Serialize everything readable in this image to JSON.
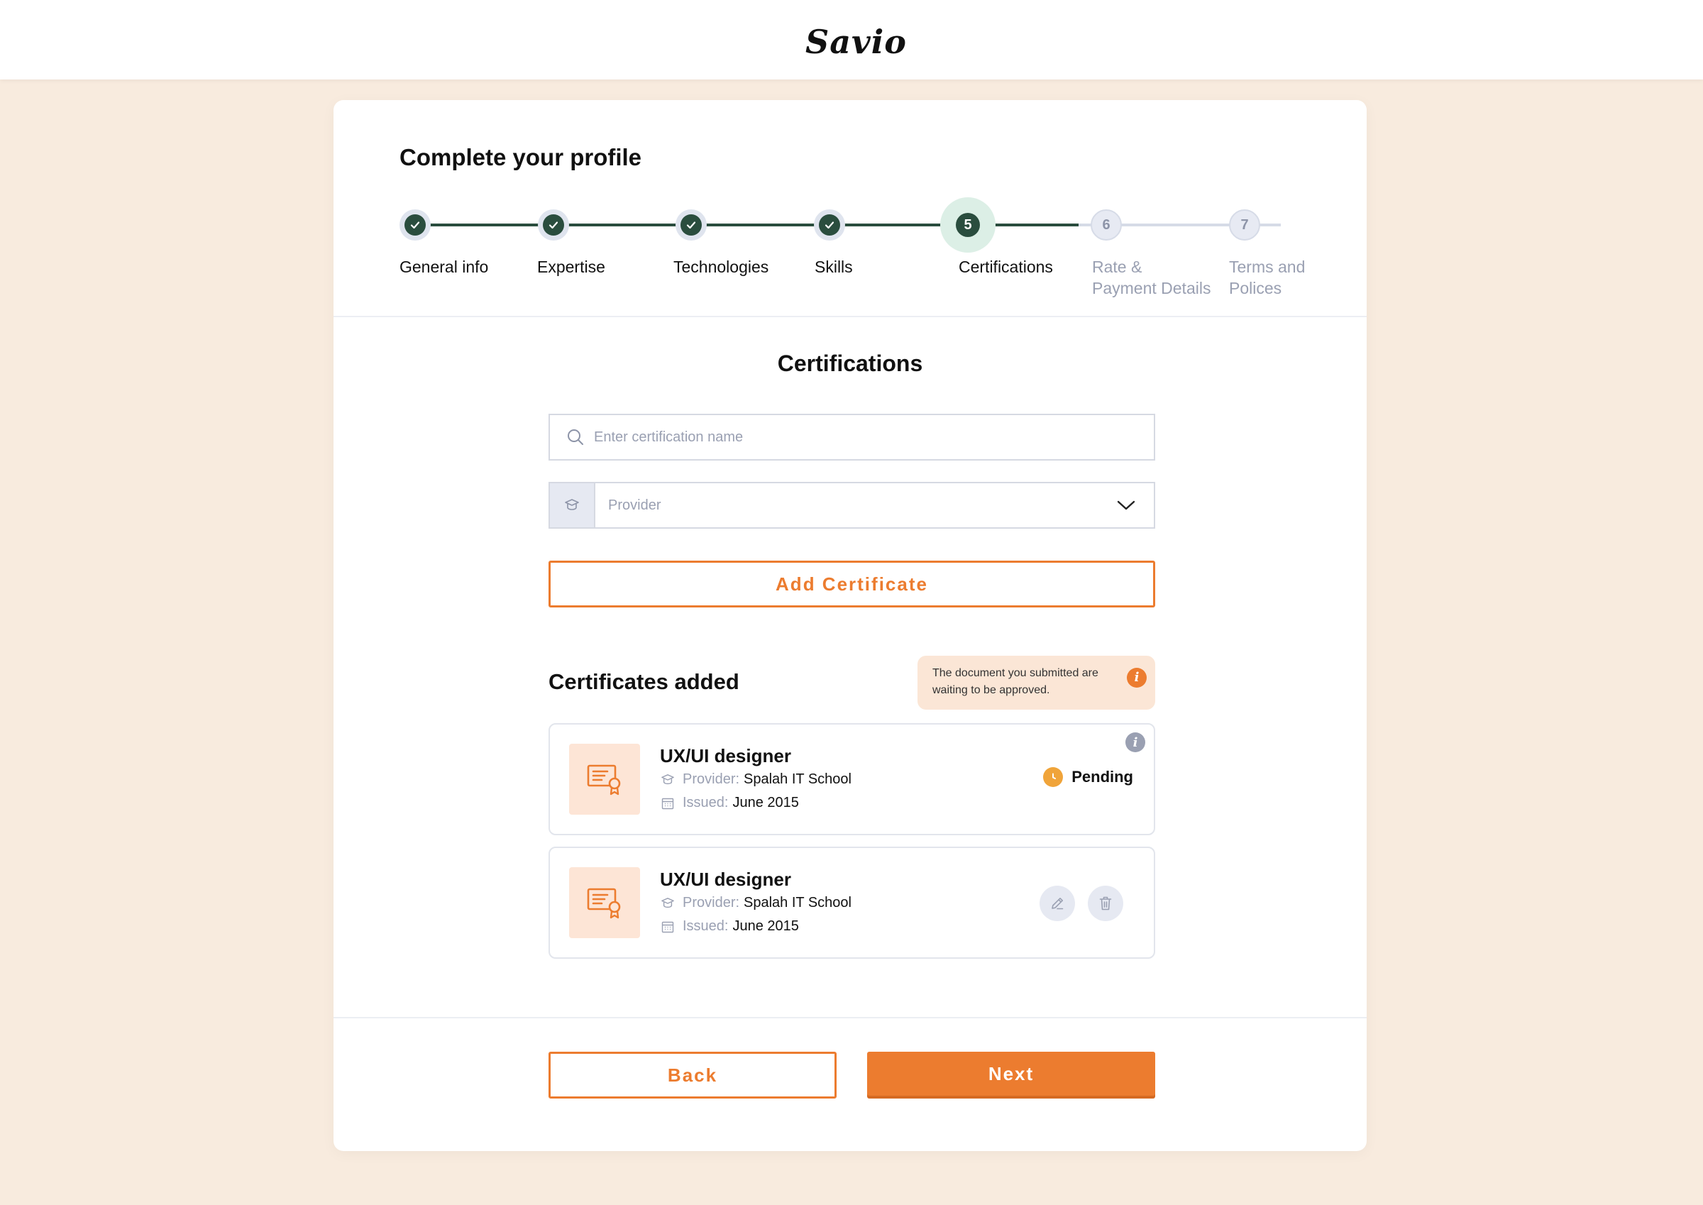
{
  "header": {
    "logo": "Savio"
  },
  "page": {
    "title": "Complete your profile"
  },
  "steps": [
    {
      "number": "1",
      "label": "General info",
      "state": "done"
    },
    {
      "number": "2",
      "label": "Expertise",
      "state": "done"
    },
    {
      "number": "3",
      "label": "Technologies",
      "state": "done"
    },
    {
      "number": "4",
      "label": "Skills",
      "state": "done"
    },
    {
      "number": "5",
      "label": "Certifications",
      "state": "active"
    },
    {
      "number": "6",
      "label": "Rate &\nPayment Details",
      "state": "todo"
    },
    {
      "number": "7",
      "label": "Terms and\nPolices",
      "state": "todo"
    }
  ],
  "section": {
    "title": "Certifications"
  },
  "form": {
    "search_placeholder": "Enter certification name",
    "search_value": "",
    "provider_placeholder": "Provider",
    "add_button": "Add Certificate"
  },
  "added": {
    "title": "Certificates added",
    "notice": "The document you submitted are waiting to be approved."
  },
  "certificates": [
    {
      "name": "UX/UI designer",
      "provider_label": "Provider:",
      "provider": "Spalah IT School",
      "issued_label": "Issued:",
      "issued": "June 2015",
      "status": "Pending"
    },
    {
      "name": "UX/UI designer",
      "provider_label": "Provider:",
      "provider": "Spalah IT School",
      "issued_label": "Issued:",
      "issued": "June 2015"
    }
  ],
  "footer": {
    "back": "Back",
    "next": "Next"
  },
  "colors": {
    "accent": "#ec7c2f",
    "done": "#2a4d3e",
    "background": "#f8ebde",
    "pending": "#f0a43a"
  },
  "icons": [
    "check-icon",
    "search-icon",
    "graduation-cap-icon",
    "chevron-down-icon",
    "info-icon",
    "certificate-icon",
    "calendar-icon",
    "clock-icon",
    "edit-icon",
    "trash-icon"
  ]
}
